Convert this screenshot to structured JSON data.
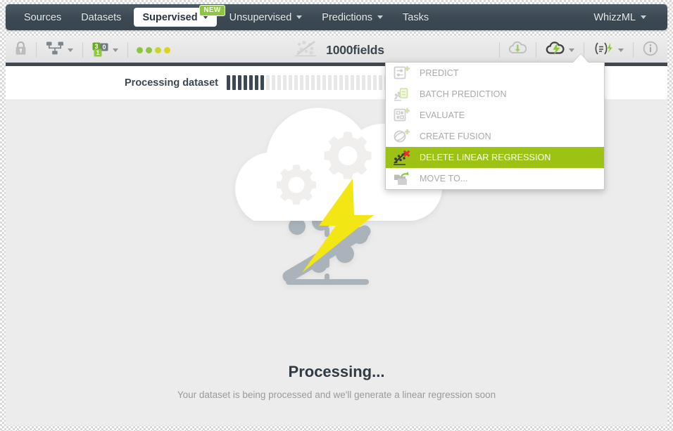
{
  "navbar": {
    "items": [
      {
        "label": "Sources",
        "caret": false,
        "active": false,
        "badge": null
      },
      {
        "label": "Datasets",
        "caret": false,
        "active": false,
        "badge": null
      },
      {
        "label": "Supervised",
        "caret": true,
        "active": true,
        "badge": "NEW"
      },
      {
        "label": "Unsupervised",
        "caret": true,
        "active": false,
        "badge": null
      },
      {
        "label": "Predictions",
        "caret": true,
        "active": false,
        "badge": null
      },
      {
        "label": "Tasks",
        "caret": false,
        "active": false,
        "badge": null
      }
    ],
    "right": {
      "label": "WhizzML",
      "caret": true
    }
  },
  "toolbar": {
    "lock_icon": "lock-icon",
    "share_icon": "share-nodes-icon",
    "fields_icon": "field-types-icon",
    "fields_badge_numerator": "3",
    "fields_badge_denominator": "1",
    "fields_badge_zero": "0",
    "status_dots": [
      "#8cc63e",
      "#8cc63e",
      "#c9d42c",
      "#dbd418"
    ],
    "title": "1000fields",
    "title_icon": "linear-regression-icon",
    "download_icon": "cloud-download-icon",
    "actions_icon": "cloud-lightning-icon",
    "config_icon": "equation-lightning-icon",
    "info_icon": "info-icon"
  },
  "progress": {
    "label": "Processing dataset",
    "total_segments": 40,
    "filled_segments": 7
  },
  "menu": {
    "items": [
      {
        "label": "PREDICT",
        "icon": "predict-icon",
        "highlight": false
      },
      {
        "label": "BATCH PREDICTION",
        "icon": "batch-prediction-icon",
        "highlight": false
      },
      {
        "label": "EVALUATE",
        "icon": "evaluate-icon",
        "highlight": false
      },
      {
        "label": "CREATE FUSION",
        "icon": "create-fusion-icon",
        "highlight": false
      },
      {
        "label": "DELETE LINEAR REGRESSION",
        "icon": "delete-linear-regression-icon",
        "highlight": true
      },
      {
        "label": "MOVE TO...",
        "icon": "move-to-icon",
        "highlight": false
      }
    ]
  },
  "content": {
    "illustration": "cloud-gears-lightning-scatter-illustration",
    "title": "Processing...",
    "subtitle": "Your dataset is being processed and we'll generate a linear regression soon"
  },
  "colors": {
    "navbar_bg": "#3b4852",
    "accent_green": "#8dc63f",
    "menu_highlight": "#9cc313",
    "content_bg": "#ececec",
    "text_dark": "#2f3a44",
    "lightning_yellow": "#f2e614"
  }
}
